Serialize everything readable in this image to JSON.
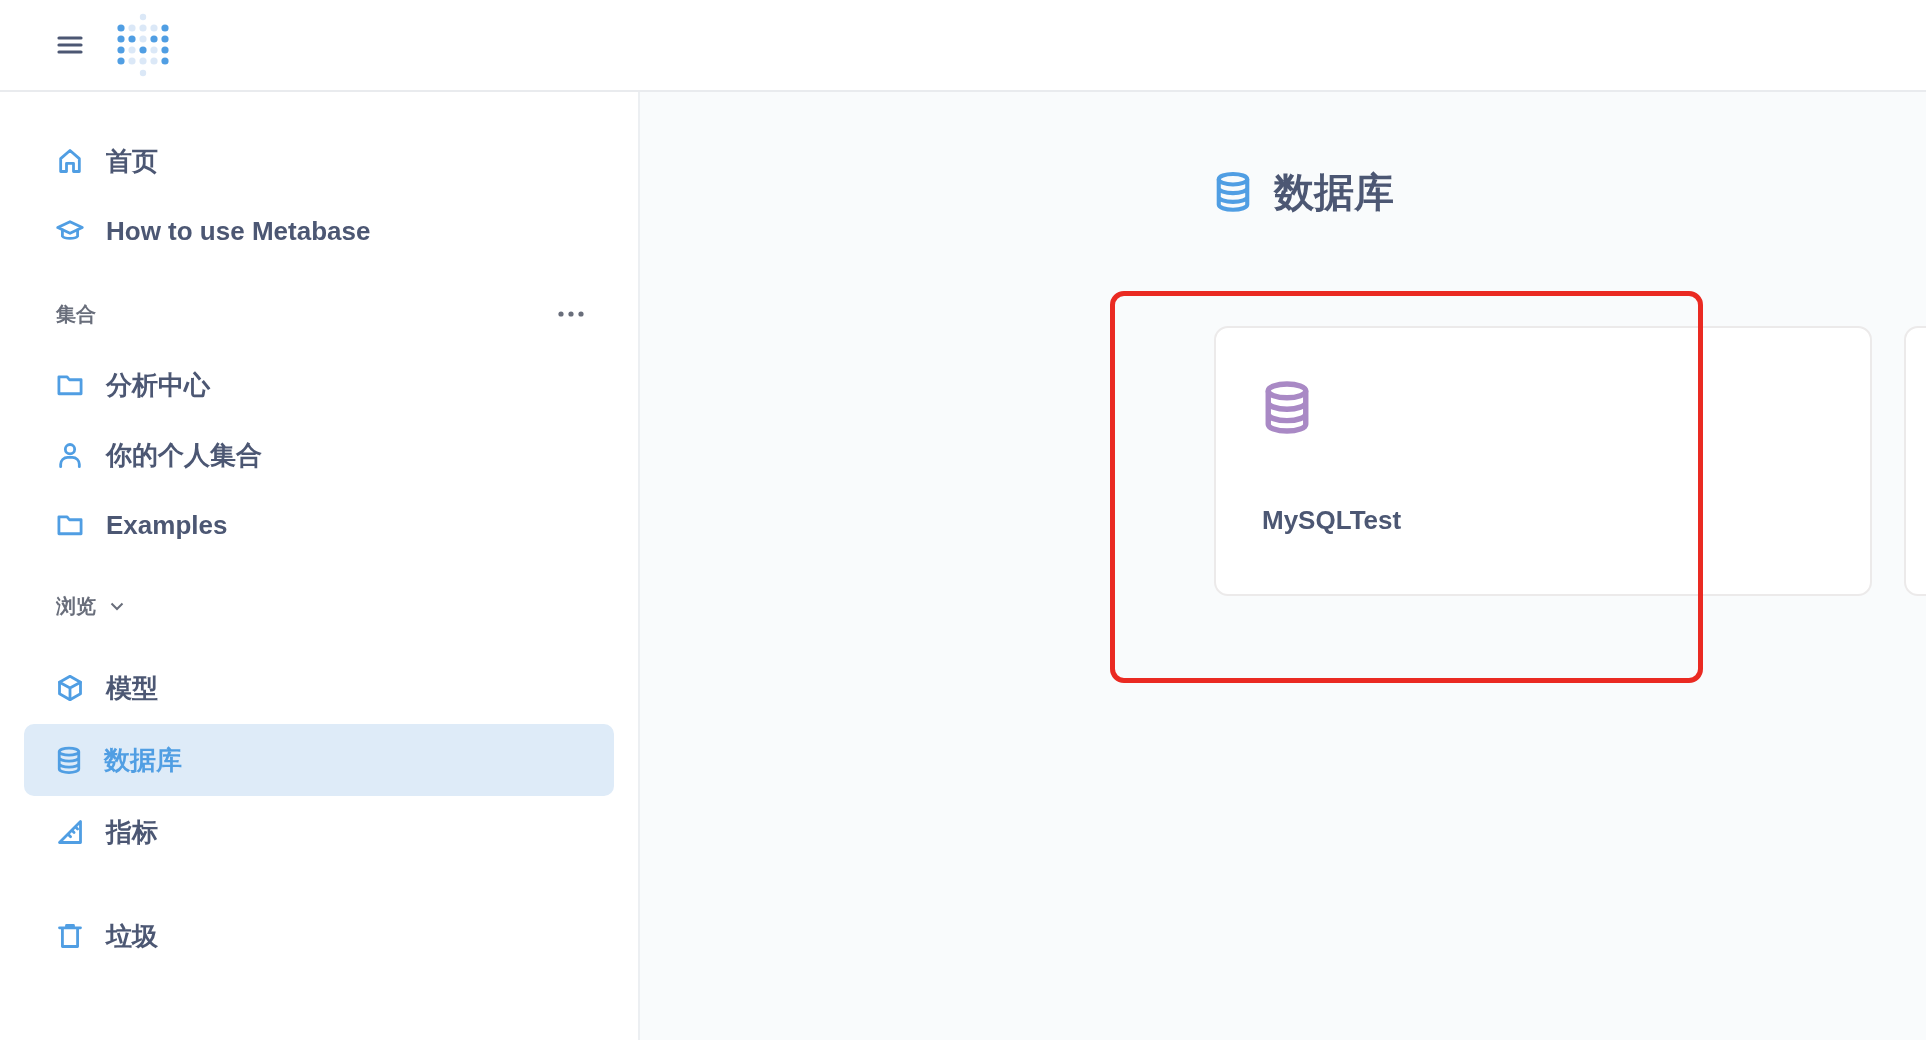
{
  "sidebar": {
    "items": [
      {
        "label": "首页",
        "kind": "home",
        "selected": false
      },
      {
        "label": "How to use Metabase",
        "kind": "cap",
        "selected": false
      }
    ],
    "sections": [
      {
        "title": "集合",
        "kind": "with-menu",
        "items": [
          {
            "label": "分析中心",
            "kind": "folder",
            "selected": false
          },
          {
            "label": "你的个人集合",
            "kind": "person",
            "selected": false
          },
          {
            "label": "Examples",
            "kind": "folder",
            "selected": false
          }
        ]
      },
      {
        "title": "浏览",
        "kind": "collapsible",
        "expanded": true,
        "items": [
          {
            "label": "模型",
            "kind": "cube",
            "selected": false
          },
          {
            "label": "数据库",
            "kind": "database",
            "selected": true
          },
          {
            "label": "指标",
            "kind": "ruler",
            "selected": false
          }
        ]
      }
    ],
    "footer_items": [
      {
        "label": "垃圾",
        "kind": "trash",
        "selected": false
      }
    ]
  },
  "main": {
    "title": "数据库",
    "databases": [
      {
        "kind": "full",
        "name": "MySQLTest"
      },
      {
        "kind": "cut-off"
      }
    ],
    "annotations": [
      {
        "kind": "highlight-box"
      }
    ]
  }
}
